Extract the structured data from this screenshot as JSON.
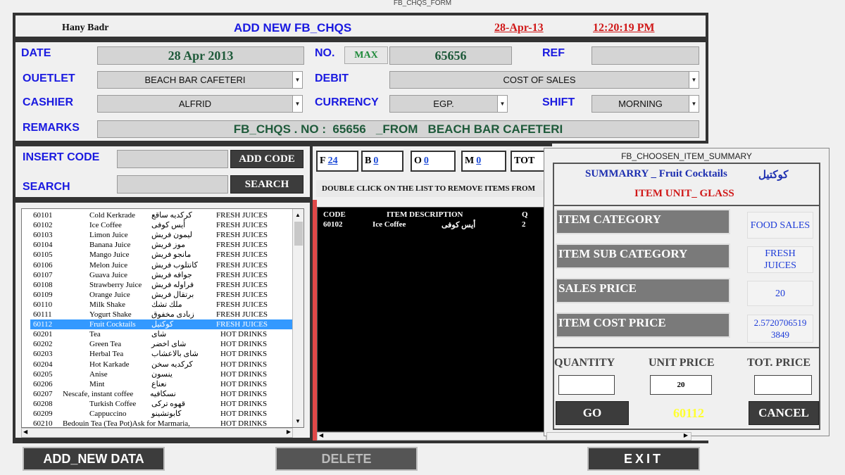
{
  "window_title": "FB_CHQS_FORM",
  "header": {
    "user": "Hany Badr",
    "title": "ADD NEW FB_CHQS",
    "date": "28-Apr-13",
    "time": "12:20:19 PM"
  },
  "form": {
    "date_label": "DATE",
    "date_value": "28 Apr 2013",
    "no_label": "NO.",
    "max_label": "MAX",
    "no_value": "65656",
    "ref_label": "REF",
    "ref_value": "",
    "outlet_label": "OUETLET",
    "outlet_value": "BEACH BAR CAFETERI",
    "debit_label": "DEBIT",
    "debit_value": "COST OF SALES",
    "cashier_label": "CASHIER",
    "cashier_value": "ALFRID",
    "currency_label": "CURRENCY",
    "currency_value": "EGP.",
    "shift_label": "SHIFT",
    "shift_value": "MORNING",
    "remarks_label": "REMARKS",
    "remarks_value": "FB_CHQS . NO :  65656   _FROM   BEACH BAR CAFETERI"
  },
  "insert": {
    "insert_label": "INSERT CODE",
    "add_code_label": "ADD CODE",
    "search_label": "SEARCH",
    "search_button_label": "SEARCH",
    "insert_value": "",
    "search_value": ""
  },
  "counters": [
    {
      "letter": "F",
      "value": "24"
    },
    {
      "letter": "B",
      "value": "0"
    },
    {
      "letter": "O",
      "value": "0"
    },
    {
      "letter": "M",
      "value": "0"
    },
    {
      "letter": "TOT",
      "value": ""
    }
  ],
  "double_click_hint": "DOUBLE CLICK ON THE LIST TO REMOVE ITEMS FROM",
  "items": [
    {
      "code": "60101",
      "name": "Cold Kerkrade",
      "arabic": "كركديه ساقع",
      "category": "FRESH JUICES"
    },
    {
      "code": "60102",
      "name": "Ice Coffee",
      "arabic": "أيس كوفى",
      "category": "FRESH JUICES"
    },
    {
      "code": "60103",
      "name": "Limon Juice",
      "arabic": "ليمون فريش",
      "category": "FRESH JUICES"
    },
    {
      "code": "60104",
      "name": "Banana Juice",
      "arabic": "موز فريش",
      "category": "FRESH JUICES"
    },
    {
      "code": "60105",
      "name": "Mango Juice",
      "arabic": "مانجو فريش",
      "category": "FRESH JUICES"
    },
    {
      "code": "60106",
      "name": "Melon Juice",
      "arabic": "كانتلوب فريش",
      "category": "FRESH JUICES"
    },
    {
      "code": "60107",
      "name": "Guava Juice",
      "arabic": "جوافه فريش",
      "category": "FRESH JUICES"
    },
    {
      "code": "60108",
      "name": "Strawberry Juice",
      "arabic": "فراوله فريش",
      "category": "FRESH JUICES"
    },
    {
      "code": "60109",
      "name": "Orange Juice",
      "arabic": "برتقال فريش",
      "category": "FRESH JUICES"
    },
    {
      "code": "60110",
      "name": "Milk Shake",
      "arabic": "ملك تشك",
      "category": "FRESH JUICES"
    },
    {
      "code": "60111",
      "name": "Yogurt Shake",
      "arabic": "زبادى مخفوق",
      "category": "FRESH JUICES"
    },
    {
      "code": "60112",
      "name": "Fruit Cocktails",
      "arabic": "كوكتيل",
      "category": "FRESH JUICES"
    },
    {
      "code": "60201",
      "name": "Tea",
      "arabic": "شاى",
      "category": "HOT DRINKS"
    },
    {
      "code": "60202",
      "name": "Green Tea",
      "arabic": "شاى اخضر",
      "category": "HOT DRINKS"
    },
    {
      "code": "60203",
      "name": "Herbal Tea",
      "arabic": "شاى بالاعشاب",
      "category": "HOT DRINKS"
    },
    {
      "code": "60204",
      "name": "Hot Karkade",
      "arabic": "كركديه سخن",
      "category": "HOT DRINKS"
    },
    {
      "code": "60205",
      "name": "Anise",
      "arabic": "ينسون",
      "category": "HOT DRINKS"
    },
    {
      "code": "60206",
      "name": "Mint",
      "arabic": "نعناع",
      "category": "HOT DRINKS"
    },
    {
      "code": "60207",
      "name": "Nescafe, instant coffee",
      "arabic": "نسكافيه",
      "category": "HOT DRINKS"
    },
    {
      "code": "60208",
      "name": "Turkish Coffee",
      "arabic": "قهوه تركى",
      "category": "HOT DRINKS"
    },
    {
      "code": "60209",
      "name": "Cappuccino",
      "arabic": "كابوتشينو",
      "category": "HOT DRINKS"
    },
    {
      "code": "60210",
      "name": "Bedouin Tea (Tea Pot)Ask for Marmaria,",
      "arabic": "",
      "category": "HOT DRINKS"
    }
  ],
  "selected_code": "60112",
  "order_list": {
    "headers": {
      "code": "CODE",
      "description": "ITEM DESCRIPTION",
      "qty": "Q"
    },
    "rows": [
      {
        "code": "60102",
        "name": "Ice Coffee",
        "arabic": "أيس كوفى",
        "qty": "2"
      }
    ]
  },
  "summary": {
    "window_title": "FB_CHOOSEN_ITEM_SUMMARY",
    "summary_line": "SUMMARRY _ Fruit Cocktails",
    "summary_arabic": "كوكتيل",
    "unit_line": "ITEM UNIT_ GLASS",
    "category_label": "ITEM CATEGORY",
    "category_value": "FOOD SALES",
    "subcategory_label": "ITEM SUB CATEGORY",
    "subcategory_value": "FRESH JUICES",
    "sales_price_label": "SALES PRICE",
    "sales_price_value": "20",
    "cost_price_label": "ITEM COST PRICE",
    "cost_price_value": "2.5720706519 3849",
    "quantity_label": "QUANTITY",
    "unit_price_label": "UNIT PRICE",
    "tot_price_label": "TOT. PRICE",
    "quantity_value": "",
    "unit_price_value": "20",
    "tot_price_value": "",
    "go_label": "GO",
    "code_display": "60112",
    "cancel_label": "CANCEL"
  },
  "footer": {
    "add_new_label": "ADD_NEW DATA",
    "delete_label": "DELETE",
    "exit_label": "EXIT"
  },
  "colors": {
    "label_blue": "#1a1ae0",
    "value_green": "#1e5a3a",
    "header_red": "#d01818",
    "selection": "#3399ff",
    "code_yellow": "#ffff30"
  }
}
